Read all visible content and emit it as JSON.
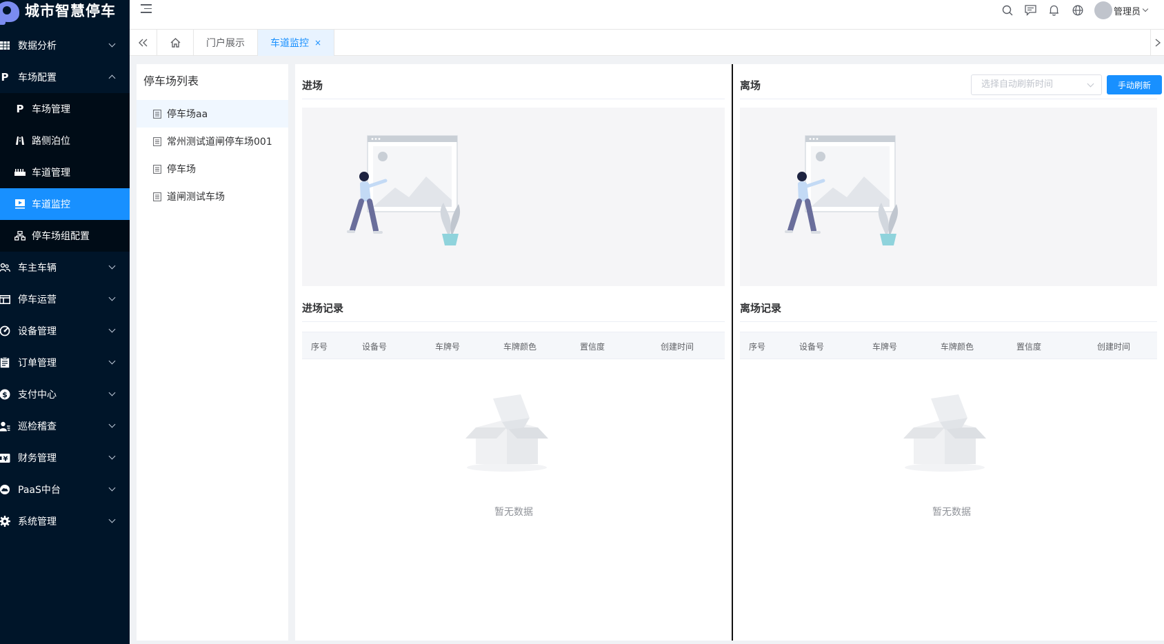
{
  "app": {
    "title": "城市智慧停车"
  },
  "sidebar": {
    "items": [
      {
        "label": "数据分析",
        "icon": "table-grid-icon"
      },
      {
        "label": "车场配置",
        "icon": "parking-p-icon",
        "expanded": true,
        "children": [
          {
            "label": "车场管理",
            "icon": "parking-p-icon"
          },
          {
            "label": "路侧泊位",
            "icon": "road-icon"
          },
          {
            "label": "车道管理",
            "icon": "lane-barrier-icon"
          },
          {
            "label": "车道监控",
            "icon": "monitor-play-icon",
            "active": true
          },
          {
            "label": "停车场组配置",
            "icon": "org-tree-icon"
          }
        ]
      },
      {
        "label": "车主车辆",
        "icon": "people-icon"
      },
      {
        "label": "停车运营",
        "icon": "layout-icon"
      },
      {
        "label": "设备管理",
        "icon": "gauge-icon"
      },
      {
        "label": "订单管理",
        "icon": "clipboard-icon"
      },
      {
        "label": "支付中心",
        "icon": "dollar-icon"
      },
      {
        "label": "巡检稽查",
        "icon": "inspector-icon"
      },
      {
        "label": "财务管理",
        "icon": "finance-icon"
      },
      {
        "label": "PaaS中台",
        "icon": "cloud-icon"
      },
      {
        "label": "系统管理",
        "icon": "gear-icon"
      }
    ]
  },
  "header": {
    "user_name": "管理员"
  },
  "tabs": [
    {
      "label": "门户展示"
    },
    {
      "label": "车道监控",
      "active": true,
      "close": "×"
    }
  ],
  "lot_panel": {
    "title": "停车场列表",
    "items": [
      "停车场aa",
      "常州测试道闸停车场001",
      "停车场",
      "道闸测试车场"
    ]
  },
  "entry": {
    "title": "进场",
    "records_title": "进场记录",
    "columns": [
      "序号",
      "设备号",
      "车牌号",
      "车牌颜色",
      "置信度",
      "创建时间"
    ],
    "empty_text": "暂无数据"
  },
  "exit": {
    "title": "离场",
    "records_title": "离场记录",
    "columns": [
      "序号",
      "设备号",
      "车牌号",
      "车牌颜色",
      "置信度",
      "创建时间"
    ],
    "empty_text": "暂无数据",
    "refresh_select_placeholder": "选择自动刷新时间",
    "refresh_button": "手动刷新"
  },
  "colors": {
    "sidebar_bg": "#001529",
    "accent": "#1890ff"
  }
}
